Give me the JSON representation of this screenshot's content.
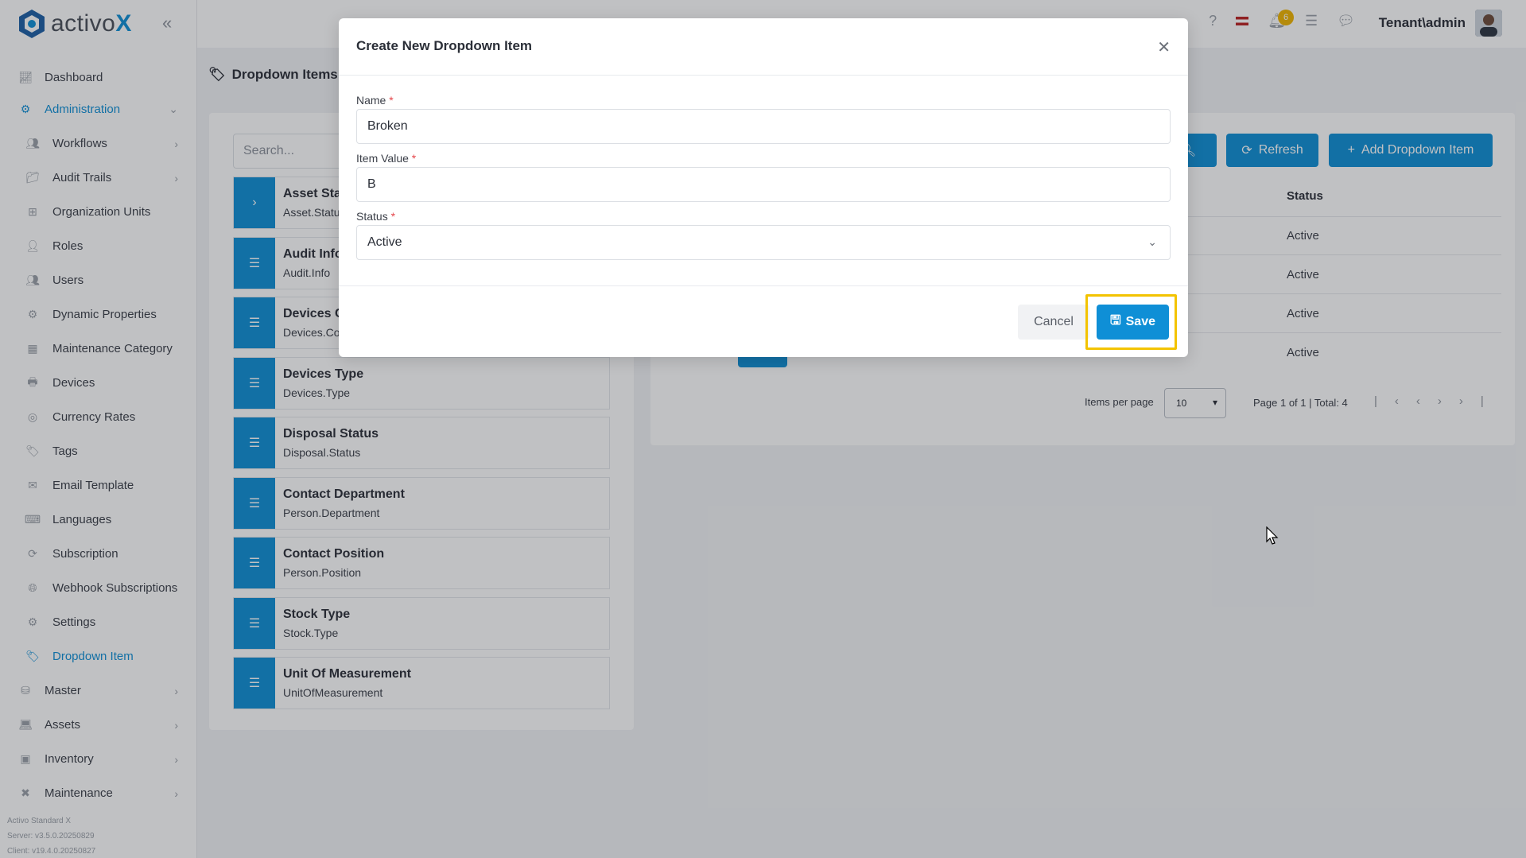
{
  "app": {
    "logo_text": "activo",
    "logo_x": "X",
    "collapse_icon": "double-chevron-left-icon"
  },
  "sidebar": {
    "items": [
      {
        "label": "Dashboard",
        "icon": "chart-icon",
        "type": "top"
      },
      {
        "label": "Administration",
        "icon": "gears-icon",
        "type": "top",
        "active": true
      },
      {
        "label": "Workflows",
        "icon": "users-icon",
        "type": "sub"
      },
      {
        "label": "Audit Trails",
        "icon": "folder-icon",
        "type": "sub"
      },
      {
        "label": "Organization Units",
        "icon": "org-icon",
        "type": "sub"
      },
      {
        "label": "Roles",
        "icon": "user-icon",
        "type": "sub"
      },
      {
        "label": "Users",
        "icon": "users-icon",
        "type": "sub"
      },
      {
        "label": "Dynamic Properties",
        "icon": "gear-icon",
        "type": "sub"
      },
      {
        "label": "Maintenance Category",
        "icon": "grid-icon",
        "type": "sub"
      },
      {
        "label": "Devices",
        "icon": "printer-icon",
        "type": "sub"
      },
      {
        "label": "Currency Rates",
        "icon": "coins-icon",
        "type": "sub"
      },
      {
        "label": "Tags",
        "icon": "tags-icon",
        "type": "sub"
      },
      {
        "label": "Email Template",
        "icon": "envelope-icon",
        "type": "sub"
      },
      {
        "label": "Languages",
        "icon": "language-icon",
        "type": "sub"
      },
      {
        "label": "Subscription",
        "icon": "refresh-icon",
        "type": "sub"
      },
      {
        "label": "Webhook Subscriptions",
        "icon": "globe-icon",
        "type": "sub"
      },
      {
        "label": "Settings",
        "icon": "gear-icon",
        "type": "sub"
      },
      {
        "label": "Dropdown Item",
        "icon": "tags-icon",
        "type": "sub",
        "active": true
      },
      {
        "label": "Master",
        "icon": "database-icon",
        "type": "top"
      },
      {
        "label": "Assets",
        "icon": "laptop-icon",
        "type": "top"
      },
      {
        "label": "Inventory",
        "icon": "box-icon",
        "type": "top"
      },
      {
        "label": "Maintenance",
        "icon": "tools-icon",
        "type": "top"
      }
    ],
    "footer": [
      "Activo Standard X",
      "Server: v3.5.0.20250829",
      "Client: v19.4.0.20250827"
    ]
  },
  "topbar": {
    "user": "Tenant\\admin",
    "notification_count": "6"
  },
  "page": {
    "breadcrumb": "Dropdown Items M"
  },
  "left_panel": {
    "search_placeholder": "Search...",
    "items": [
      {
        "title": "Asset Stat",
        "code": "Asset.Status"
      },
      {
        "title": "Audit Info",
        "code": "Audit.Info"
      },
      {
        "title": "Devices C",
        "code": "Devices.Co"
      },
      {
        "title": "Devices Type",
        "code": "Devices.Type"
      },
      {
        "title": "Disposal Status",
        "code": "Disposal.Status"
      },
      {
        "title": "Contact Department",
        "code": "Person.Department"
      },
      {
        "title": "Contact Position",
        "code": "Person.Position"
      },
      {
        "title": "Stock Type",
        "code": "Stock.Type"
      },
      {
        "title": "Unit Of Measurement",
        "code": "UnitOfMeasurement"
      }
    ]
  },
  "right_panel": {
    "refresh_label": "Refresh",
    "add_label": "Add Dropdown Item",
    "status_header": "Status",
    "statuses": [
      "Active",
      "Active",
      "Active",
      "Active"
    ],
    "items_per_page_label": "Items per page",
    "items_per_page": "10",
    "page_info": "Page 1 of 1 | Total: 4"
  },
  "modal": {
    "title": "Create New Dropdown Item",
    "name_label": "Name",
    "name_value": "Broken",
    "item_value_label": "Item Value",
    "item_value": "B",
    "status_label": "Status",
    "status_value": "Active",
    "cancel_label": "Cancel",
    "save_label": "Save",
    "required_mark": "*"
  },
  "colors": {
    "accent": "#0f8fd6",
    "highlight": "#f3c300",
    "required": "#e5484d",
    "badge": "#f0b400"
  }
}
